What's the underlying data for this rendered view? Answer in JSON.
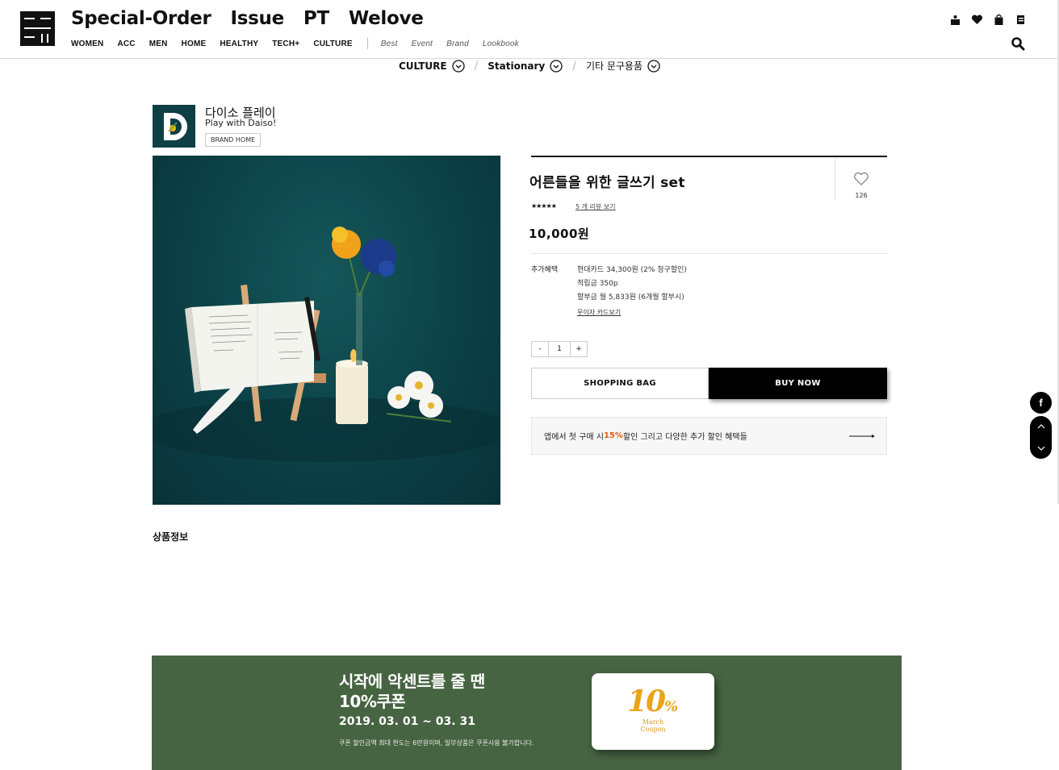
{
  "header": {
    "main_menu": [
      "Special-Order",
      "Issue",
      "PT",
      "Welove"
    ],
    "sub_menu": [
      "WOMEN",
      "ACC",
      "MEN",
      "HOME",
      "HEALTHY",
      "TECH+",
      "CULTURE"
    ],
    "sub_menu_italic": [
      "Best",
      "Event",
      "Brand",
      "Lookbook"
    ]
  },
  "breadcrumb": [
    "CULTURE",
    "Stationary",
    "기타 문구용품"
  ],
  "brand": {
    "name": "다이소 플레이",
    "tagline": "Play with Daiso!",
    "home_button": "BRAND HOME"
  },
  "product": {
    "title": "어른들을 위한 글쓰기 set",
    "likes": "126",
    "stars": "★★★★★",
    "review_link": "5 개 리뷰 보기",
    "price": "10,000원",
    "benefit_label": "추가혜택",
    "benefits": [
      "현대카드 34,300원 (2% 청구할인)",
      "적립금 350p",
      "할부금 월 5,833원 (6개월 할부시)"
    ],
    "card_link": "무이자 카드보기",
    "qty_minus": "-",
    "qty_value": "1",
    "qty_plus": "+",
    "bag_button": "SHOPPING BAG",
    "buy_button": "BUY NOW",
    "app_banner_pre": "앱에서 첫 구매 시 ",
    "app_banner_pct": "15%",
    "app_banner_post": " 할인 그리고 다양한 추가 할인 혜택들"
  },
  "section_title": "상품정보",
  "float": {
    "facebook": "f",
    "up": "^",
    "down": "v"
  },
  "coupon": {
    "title_line1": "시작에 악센트를 줄 땐",
    "title_line2": "10%쿠폰",
    "date": "2019. 03. 01 ~ 03. 31",
    "note": "쿠폰 할인금액 최대 한도는 6만원이며, 일부상품은 쿠폰사용 불가합니다.",
    "card_big": "10",
    "card_pct": "%",
    "card_sub1": "March",
    "card_sub2": "Coupon"
  },
  "colors": {
    "accent_orange": "#e8590c",
    "coupon_green": "#476442",
    "coupon_gold": "#e9a418",
    "product_bg": "#0b4147"
  }
}
